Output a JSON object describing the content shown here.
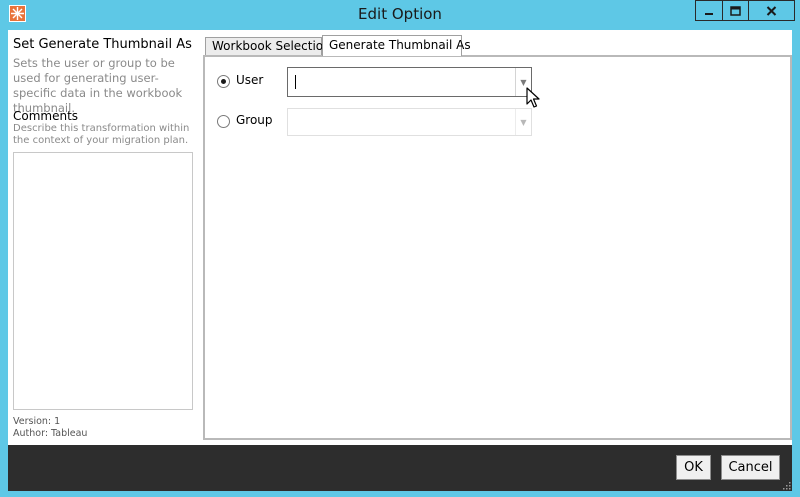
{
  "window": {
    "title": "Edit Option",
    "accent_color": "#5ec8e6",
    "caption_buttons": [
      "minimize-icon",
      "maximize-icon",
      "close-icon"
    ]
  },
  "left_pane": {
    "title": "Set Generate Thumbnail As",
    "description": "Sets the user or group to be used for generating user-specific data in the workbook thumbnail.",
    "comments_label": "Comments",
    "comments_description": "Describe this transformation within the context of your migration plan.",
    "comments_value": "",
    "version": "Version:  1",
    "author": "Author:   Tableau"
  },
  "tabs": [
    {
      "label": "Workbook Selection",
      "active": false
    },
    {
      "label": "Generate Thumbnail As",
      "active": true
    }
  ],
  "options": {
    "user": {
      "label": "User",
      "selected": true,
      "value": ""
    },
    "group": {
      "label": "Group",
      "selected": false,
      "value": "",
      "enabled": false
    }
  },
  "footer": {
    "ok_label": "OK",
    "cancel_label": "Cancel"
  }
}
